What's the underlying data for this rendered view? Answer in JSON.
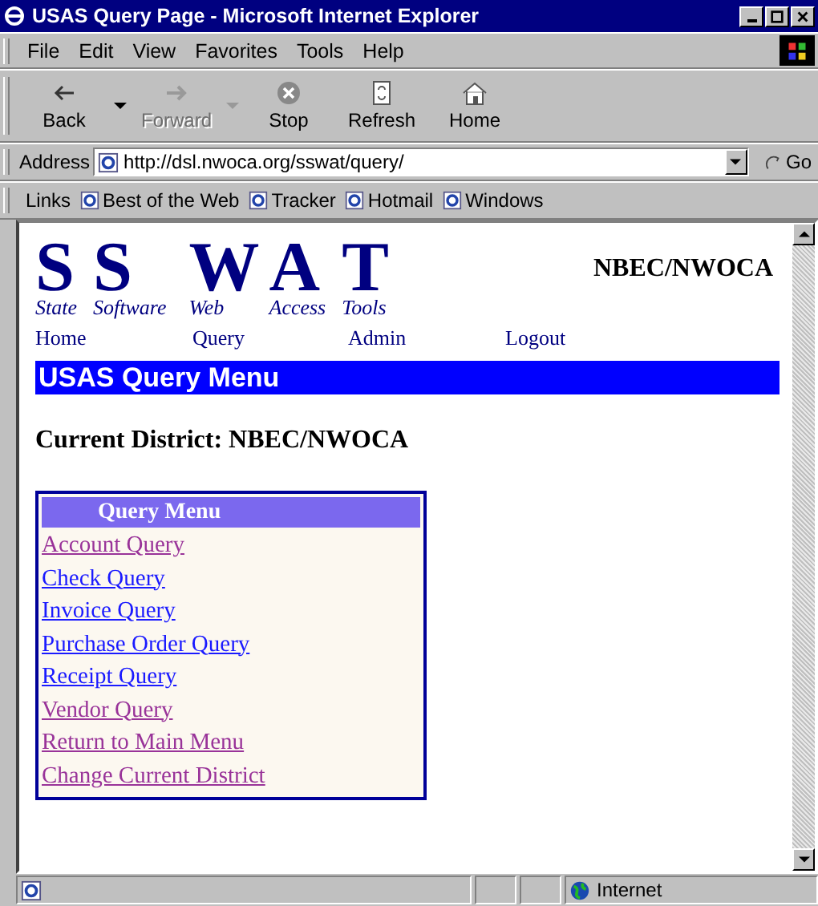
{
  "window": {
    "title": "USAS Query Page - Microsoft Internet Explorer"
  },
  "menu": [
    "File",
    "Edit",
    "View",
    "Favorites",
    "Tools",
    "Help"
  ],
  "toolbar": [
    {
      "label": "Back",
      "kind": "back",
      "disabled": false
    },
    {
      "label": "Forward",
      "kind": "forward",
      "disabled": true
    },
    {
      "label": "Stop",
      "kind": "stop",
      "disabled": false
    },
    {
      "label": "Refresh",
      "kind": "refresh",
      "disabled": false
    },
    {
      "label": "Home",
      "kind": "home",
      "disabled": false
    }
  ],
  "address": {
    "label": "Address",
    "value": "http://dsl.nwoca.org/sswat/query/",
    "go": "Go"
  },
  "links": {
    "label": "Links",
    "items": [
      "Best of the Web",
      "Tracker",
      "Hotmail",
      "Windows"
    ]
  },
  "page": {
    "logo": [
      {
        "letter": "S",
        "word": "State"
      },
      {
        "letter": "S",
        "word": "Software"
      },
      {
        "letter": "W",
        "word": "Web"
      },
      {
        "letter": "A",
        "word": "Access"
      },
      {
        "letter": "T",
        "word": "Tools"
      }
    ],
    "org": "NBEC/NWOCA",
    "nav": [
      "Home",
      "Query",
      "Admin",
      "Logout"
    ],
    "banner": "USAS Query Menu",
    "district": "Current District: NBEC/NWOCA",
    "menu_title": "Query Menu",
    "menu_links": [
      {
        "label": "Account Query",
        "visited": true
      },
      {
        "label": "Check Query",
        "visited": false
      },
      {
        "label": "Invoice Query",
        "visited": false
      },
      {
        "label": "Purchase Order Query",
        "visited": false
      },
      {
        "label": "Receipt Query",
        "visited": false
      },
      {
        "label": "Vendor Query",
        "visited": true
      },
      {
        "label": "Return to Main Menu",
        "visited": true
      },
      {
        "label": "Change Current District",
        "visited": true
      }
    ]
  },
  "status_bar": {
    "zone": "Internet"
  }
}
